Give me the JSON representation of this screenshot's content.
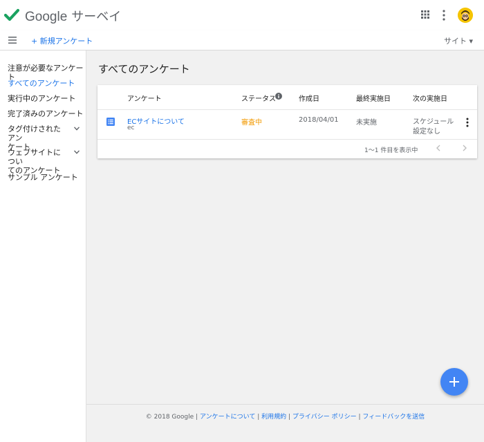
{
  "app": {
    "brand_google": "Google",
    "brand_product": "サーベイ"
  },
  "subbar": {
    "new_survey": "+ 新規アンケート",
    "site_menu": "サイト ▾"
  },
  "sidebar": {
    "items": [
      {
        "label": "注意が必要なアンケート"
      },
      {
        "label": "すべてのアンケート"
      },
      {
        "label": "実行中のアンケート"
      },
      {
        "label": "完了済みのアンケート"
      },
      {
        "label_line1": "タグ付けされたアン",
        "label_line2": "ケート"
      },
      {
        "label_line1": "ウェブサイトについ",
        "label_line2": "てのアンケート"
      },
      {
        "label": "サンプル アンケート"
      }
    ]
  },
  "main": {
    "title": "すべてのアンケート",
    "table": {
      "headers": {
        "survey": "アンケート",
        "status": "ステータス",
        "created": "作成日",
        "last_run": "最終実施日",
        "next_run": "次の実施日"
      },
      "rows": [
        {
          "name": "ECサイトについて",
          "sub": "ec",
          "status": "審査中",
          "created": "2018/04/01",
          "last_run": "未実施",
          "next_line1": "スケジュール",
          "next_line2": "設定なし"
        }
      ],
      "pager": "1〜1 件目を表示中"
    }
  },
  "footer": {
    "copyright": "© 2018 Google",
    "links": [
      "アンケートについて",
      "利用規約",
      "プライバシー ポリシー",
      "フィードバックを送信"
    ]
  },
  "icons": {
    "logo": "checkmark-logo-icon",
    "apps": "apps-grid-icon",
    "more": "more-vert-icon",
    "menu": "hamburger-menu-icon",
    "info": "info-icon",
    "survey": "list-document-icon",
    "add": "plus-icon"
  },
  "colors": {
    "accent": "#1a73e8",
    "logo_green": "#1aa260",
    "status_review": "#f29900",
    "fab": "#4285f4",
    "avatar": "#f5c400"
  }
}
